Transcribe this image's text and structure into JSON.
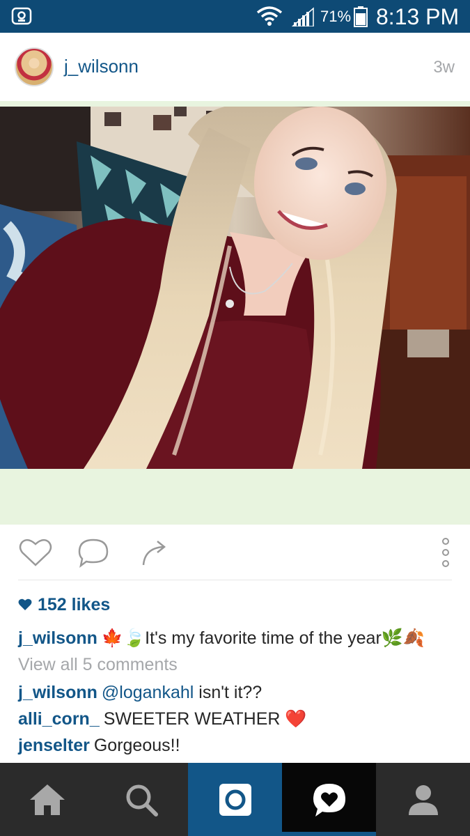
{
  "status_bar": {
    "battery": "71%",
    "time": "8:13 PM",
    "background": "#0e4a75"
  },
  "post": {
    "username": "j_wilsonn",
    "time_ago": "3w",
    "likes": "152 likes",
    "caption": {
      "user": "j_wilsonn",
      "emoji_before": "🍁🍃",
      "text": "It's my favorite time of the year",
      "emoji_after": "🌿🍂"
    },
    "view_all": "View all 5 comments",
    "comments": [
      {
        "user": "j_wilsonn",
        "mention": "@logankahl",
        "text": " isn't it??"
      },
      {
        "user": "alli_corn_",
        "text": "SWEETER WEATHER",
        "emoji": "❤️"
      },
      {
        "user": "jenselter",
        "text": "Gorgeous!!"
      }
    ]
  },
  "actions": {
    "like_icon": "heart-outline-icon",
    "comment_icon": "comment-bubble-icon",
    "share_icon": "share-arrow-icon",
    "more_icon": "more-vertical-icon"
  },
  "nav": {
    "items": [
      "home-icon",
      "search-icon",
      "camera-icon",
      "activity-heart-icon",
      "profile-icon"
    ],
    "active": "activity-heart-icon"
  },
  "colors": {
    "link_blue": "#125688",
    "gray": "#a5a7aa",
    "nav_bg": "#2b2b2b",
    "camera_bg": "#125688"
  }
}
